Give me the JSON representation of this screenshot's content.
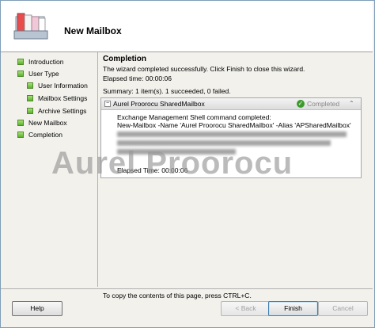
{
  "header": {
    "title": "New Mailbox",
    "icon": "mailbox-stack-icon"
  },
  "nav": {
    "items": [
      {
        "label": "Introduction",
        "indent": false
      },
      {
        "label": "User Type",
        "indent": false
      },
      {
        "label": "User Information",
        "indent": true
      },
      {
        "label": "Mailbox Settings",
        "indent": true
      },
      {
        "label": "Archive Settings",
        "indent": true
      },
      {
        "label": "New Mailbox",
        "indent": false
      },
      {
        "label": "Completion",
        "indent": false
      }
    ]
  },
  "main": {
    "title": "Completion",
    "message": "The wizard completed successfully. Click Finish to close this wizard.",
    "elapsed": "Elapsed time: 00:00:06",
    "summary": "Summary: 1 item(s). 1 succeeded, 0 failed."
  },
  "task": {
    "name": "Aurel Proorocu SharedMailbox",
    "status": "Completed",
    "line1": "Exchange Management Shell command completed:",
    "line2": "New-Mailbox -Name 'Aurel Proorocu SharedMailbox' -Alias 'APSharedMailbox'",
    "elapsed": "Elapsed Time: 00:00:06"
  },
  "watermark": "Aurel Proorocu",
  "footer": {
    "copy_hint": "To copy the contents of this page, press CTRL+C.",
    "help": "Help",
    "back": "< Back",
    "finish": "Finish",
    "cancel": "Cancel"
  },
  "colors": {
    "status_ok": "#3c9a2b",
    "nav_box": "#5bb12d"
  }
}
